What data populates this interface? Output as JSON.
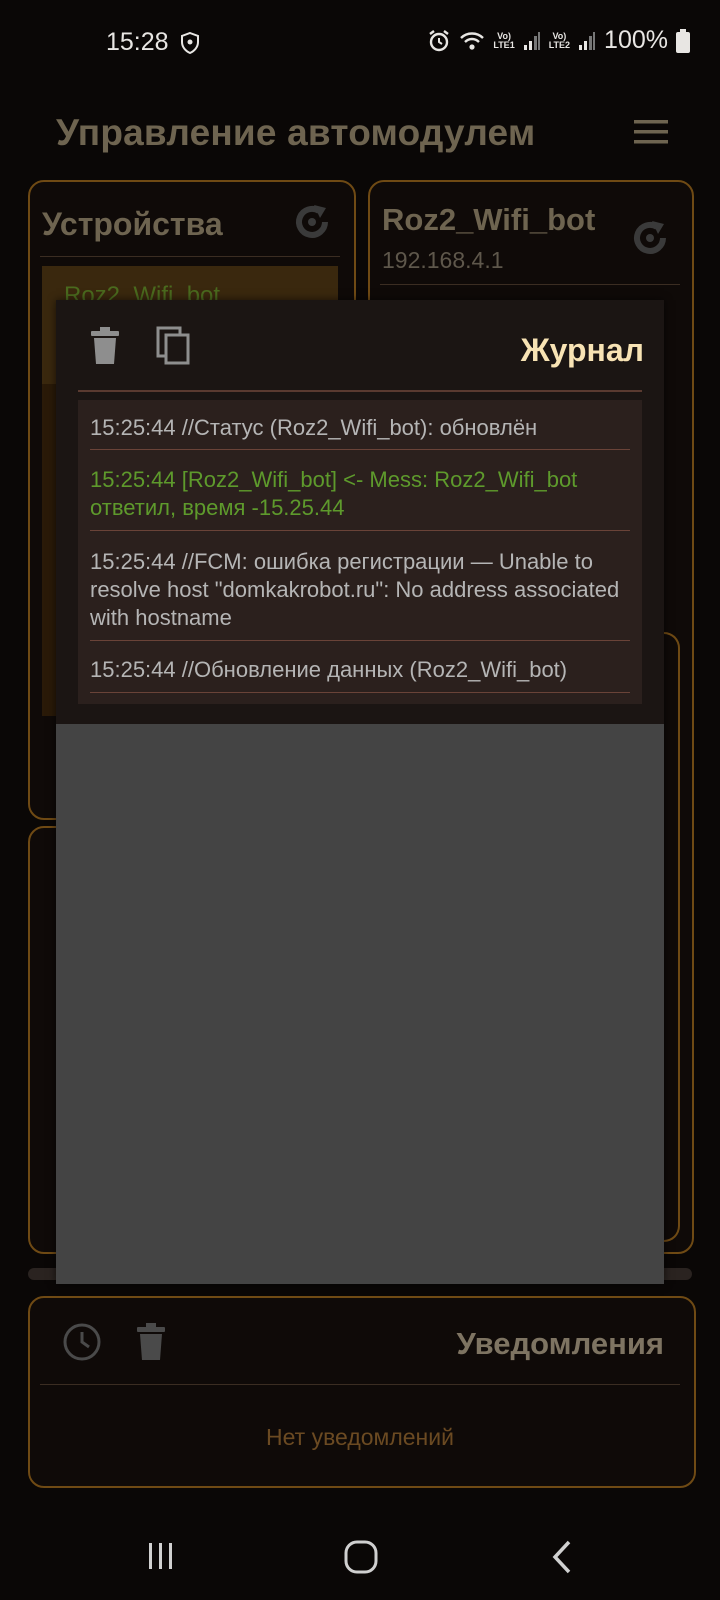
{
  "status_bar": {
    "time": "15:28",
    "battery_text": "100%",
    "lte1_top": "Vo)",
    "lte1_bottom": "LTE1",
    "lte2_top": "Vo)",
    "lte2_bottom": "LTE2"
  },
  "header": {
    "title": "Управление автомодулем",
    "menu_icon": "hamburger-icon"
  },
  "devices": {
    "title": "Устройства",
    "selected_item": "Roz2_Wifi_bot"
  },
  "device_panel": {
    "name": "Roz2_Wifi_bot",
    "ip": "192.168.4.1"
  },
  "journal": {
    "title": "Журнал",
    "entries": [
      {
        "text": "15:25:44 //Статус (Roz2_Wifi_bot): обновлён",
        "color": "#b5b5b5"
      },
      {
        "text": "15:25:44 [Roz2_Wifi_bot] <- Mess: Roz2_Wifi_bot ответил, время -15.25.44",
        "color": "#5e9a2c"
      },
      {
        "text": "15:25:44 //FCM: ошибка регистрации — Unable to resolve host \"domkakrobot.ru\": No address associated with hostname",
        "color": "#b5b5b5"
      },
      {
        "text": "15:25:44 //Обновление данных (Roz2_Wifi_bot)",
        "color": "#b5b5b5"
      }
    ]
  },
  "notifications": {
    "title": "Уведомления",
    "empty_text": "Нет уведомлений"
  },
  "colors": {
    "accent_border": "#6f4a14",
    "journal_title": "#f8e3b4",
    "log_green": "#5e9a2c"
  }
}
